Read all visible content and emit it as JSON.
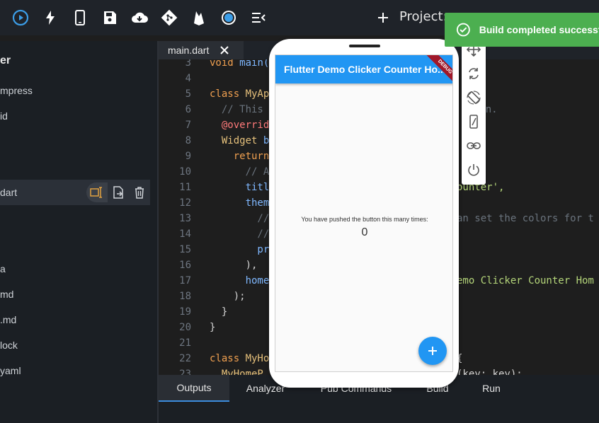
{
  "toolbar": {
    "icons": [
      "run-icon",
      "hot-reload-icon",
      "device-icon",
      "save-icon",
      "download-icon",
      "git-icon",
      "firebase-icon",
      "record-icon",
      "menu-collapse-icon"
    ],
    "project_label": "Project:"
  },
  "toast": {
    "text": "Build completed successfu"
  },
  "sidebar": {
    "header": "er",
    "items": [
      "mpress",
      "id",
      "dart",
      "a",
      "md",
      ".md",
      "lock",
      "yaml"
    ]
  },
  "editor": {
    "tab": "main.dart",
    "lines": [
      {
        "n": "3"
      },
      {
        "n": "4"
      },
      {
        "n": "5"
      },
      {
        "n": "6"
      },
      {
        "n": "7"
      },
      {
        "n": "8"
      },
      {
        "n": "9"
      },
      {
        "n": "10"
      },
      {
        "n": "11"
      },
      {
        "n": "12"
      },
      {
        "n": "13"
      },
      {
        "n": "14"
      },
      {
        "n": "15"
      },
      {
        "n": "16"
      },
      {
        "n": "17"
      },
      {
        "n": "18"
      },
      {
        "n": "19"
      },
      {
        "n": "20"
      },
      {
        "n": "21"
      },
      {
        "n": "22"
      },
      {
        "n": "23"
      }
    ],
    "code": {
      "l3a": "void ",
      "l3b": "main(",
      "l5a": "class ",
      "l5b": "MyAp",
      "l6": "  // This",
      "l6r": "ation.",
      "l7": "  @overrid",
      "l8a": "  Widget ",
      "l8b": "b",
      "l9": "    return",
      "l10": "      // A",
      "l11a": "      titl",
      "l11b": "ounter',",
      "l12": "      them",
      "l13a": "        //",
      "l13b": "an set the colors for t",
      "l14": "        //",
      "l15": "        pr",
      "l16": "      ),",
      "l17a": "      home",
      "l17b": "emo Clicker Counter Hom",
      "l18": "    );",
      "l19": "  }",
      "l20": "}",
      "l22a": "class ",
      "l22b": "MyHo",
      "l22c": "{",
      "l23a": "  MyHomeP",
      "l23b": "(key: key);"
    }
  },
  "bottom": {
    "tabs": [
      "Outputs",
      "Analyzer",
      "Pub Commands",
      "Build",
      "Run"
    ]
  },
  "phone": {
    "title": "Flutter Demo Clicker Counter Ho...",
    "debug": "DEBUG",
    "message": "You have pushed the button this many times:",
    "count": "0"
  }
}
